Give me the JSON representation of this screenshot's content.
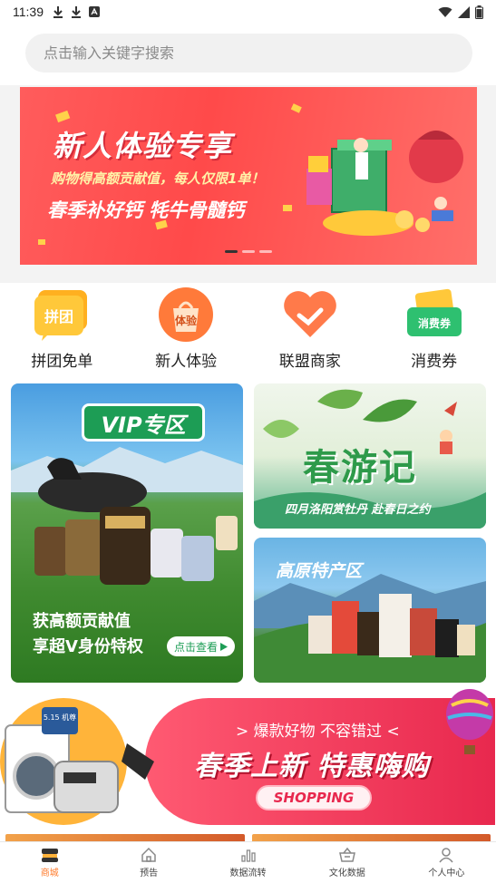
{
  "status_bar": {
    "time": "11:39"
  },
  "search": {
    "placeholder": "点击输入关键字搜索"
  },
  "hero_banner": {
    "title": "新人体验专享",
    "subtitle": "购物得高额贡献值，每人仅限1单！",
    "tagline": "春季补好钙  牦牛骨髓钙",
    "slides": 3,
    "active_slide": 1
  },
  "categories": [
    {
      "label": "拼团免单",
      "badge": "拼团",
      "icon": "group-buy-icon"
    },
    {
      "label": "新人体验",
      "badge": "体验",
      "icon": "new-user-bag-icon"
    },
    {
      "label": "联盟商家",
      "badge": "",
      "icon": "alliance-heart-icon"
    },
    {
      "label": "消费券",
      "badge": "消费券",
      "icon": "coupon-icon"
    }
  ],
  "vip_card": {
    "tag": "VIP专区",
    "line1": "获高额贡献值",
    "line2": "享超V身份特权",
    "button": "点击查看"
  },
  "spring_card": {
    "title": "春游记",
    "subtitle": "四月洛阳赏牡丹  赴春日之约"
  },
  "plateau_card": {
    "title": "高原特产区"
  },
  "shopping_banner": {
    "line1": "> 爆款好物  不容错过 <",
    "line2": "春季上新  特惠嗨购",
    "button": "SHOPPING",
    "product_label": "5.15 机尊"
  },
  "tabs": [
    {
      "label": "商城",
      "icon": "shop-icon",
      "active": true
    },
    {
      "label": "预告",
      "icon": "home-icon",
      "active": false
    },
    {
      "label": "数据流转",
      "icon": "bar-chart-icon",
      "active": false
    },
    {
      "label": "文化数据",
      "icon": "basket-icon",
      "active": false
    },
    {
      "label": "个人中心",
      "icon": "person-icon",
      "active": false
    }
  ],
  "colors": {
    "accent": "#ff7a2a",
    "banner_red": "#ff4a4a",
    "vip_green": "#1d9d55",
    "shop_pink": "#e8284e"
  }
}
